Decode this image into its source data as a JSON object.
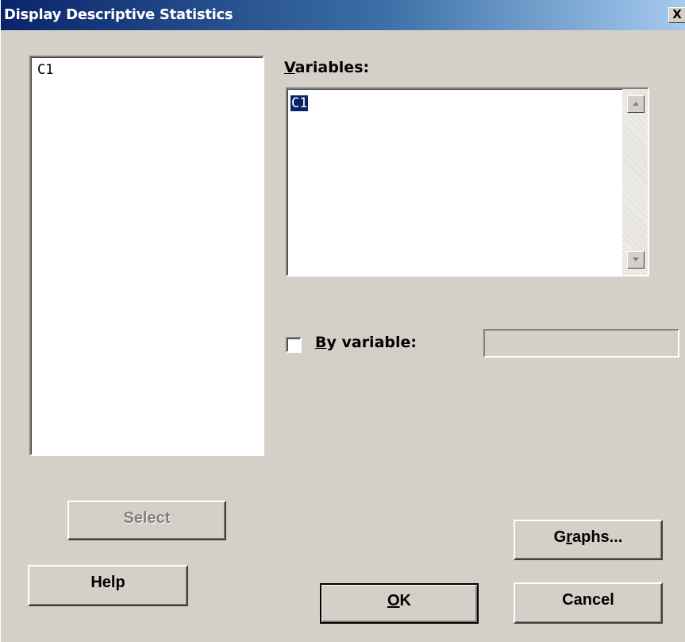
{
  "window": {
    "title": "Display Descriptive Statistics",
    "close_glyph": "X"
  },
  "variable_list": {
    "items": [
      "C1"
    ]
  },
  "variables": {
    "label_accel": "V",
    "label_rest": "ariables:",
    "value": "C1"
  },
  "by_variable": {
    "checked": false,
    "label_accel": "B",
    "label_rest": "y variable:",
    "value": ""
  },
  "buttons": {
    "select": "Select",
    "help": "Help",
    "graphs_pre": "G",
    "graphs_accel": "r",
    "graphs_post": "aphs...",
    "ok_accel": "O",
    "ok_rest": "K",
    "cancel": "Cancel"
  },
  "colors": {
    "title_gradient_start": "#0a246a",
    "title_gradient_end": "#a6caf0",
    "selection": "#0a246a",
    "face": "#d4d0c8"
  },
  "icons": {
    "scroll_up": "triangle-up-icon",
    "scroll_down": "triangle-down-icon"
  }
}
